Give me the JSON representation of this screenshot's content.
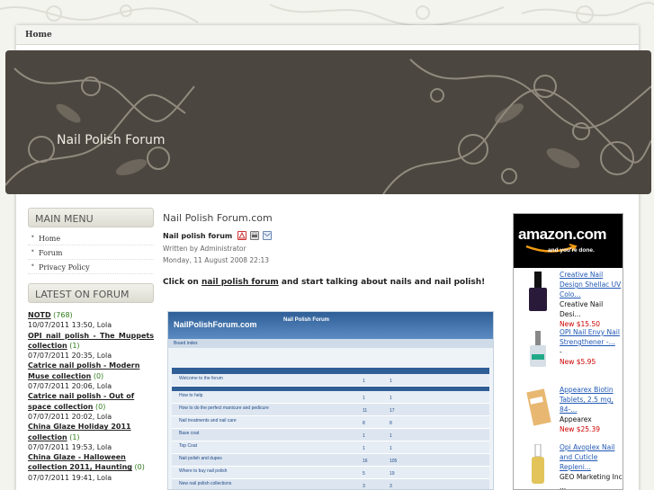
{
  "nav": {
    "home": "Home"
  },
  "banner": {
    "title": "Nail Polish Forum"
  },
  "main_menu": {
    "title": "MAIN MENU",
    "items": [
      {
        "label": "Home"
      },
      {
        "label": "Forum"
      },
      {
        "label": "Privacy Policy"
      }
    ]
  },
  "latest_forum": {
    "title": "LATEST ON FORUM",
    "posts": [
      {
        "title": "NOTD",
        "count": "(768)",
        "meta": "10/07/2011 13:50, Lola"
      },
      {
        "title": "OPI nail polish - The Muppets collection",
        "count": "(1)",
        "meta": "07/07/2011 20:35, Lola"
      },
      {
        "title": "Catrice nail polish - Modern Muse collection",
        "count": "(0)",
        "meta": "07/07/2011 20:06, Lola"
      },
      {
        "title": "Catrice nail polish - Out of space collection",
        "count": "(0)",
        "meta": "07/07/2011 20:02, Lola"
      },
      {
        "title": "China Glaze Holiday 2011 collection",
        "count": "(1)",
        "meta": "07/07/2011 19:53, Lola"
      },
      {
        "title": "China Glaze - Halloween collection 2011, Haunting",
        "count": "(0)",
        "meta": "07/07/2011 19:41, Lola"
      }
    ]
  },
  "content": {
    "site_title": "Nail Polish Forum.com",
    "article_title": "Nail polish forum",
    "written_by": "Written by Administrator",
    "date": "Monday, 11 August 2008 22:13",
    "cta_prefix": "Click on ",
    "cta_link": "nail polish forum",
    "cta_suffix": " and start talking about nails and nail polish!"
  },
  "embedded_screenshot": {
    "logo": "NailPolishForum.com",
    "header_title": "Nail Polish Forum",
    "board_index": "Board index",
    "rows": [
      {
        "name": "Welcome to the forum",
        "topics": "1",
        "posts": "1"
      },
      {
        "name": "How to help",
        "topics": "1",
        "posts": "1"
      },
      {
        "name": "How to do the perfect manicure and pedicure",
        "topics": "11",
        "posts": "17"
      },
      {
        "name": "Nail treatments and nail care",
        "topics": "8",
        "posts": "8"
      },
      {
        "name": "Base coat",
        "topics": "1",
        "posts": "1"
      },
      {
        "name": "Top Coat",
        "topics": "1",
        "posts": "1"
      },
      {
        "name": "Nail polish and dupes",
        "topics": "16",
        "posts": "105"
      },
      {
        "name": "Where to buy nail polish",
        "topics": "5",
        "posts": "19"
      },
      {
        "name": "New nail polish collections",
        "topics": "3",
        "posts": "3"
      }
    ]
  },
  "amazon": {
    "logo": "amazon.com",
    "tagline": "and you're done.",
    "products": [
      {
        "title": "Creative Nail Design Shellac UV Colo...",
        "brand": "Creative Nail Desi...",
        "price": "New $15.50",
        "color": "#2a1a3a"
      },
      {
        "title": "OPI Nail Envy Nail Strengthener -...",
        "brand": "-",
        "price": "New $5.95",
        "color": "#d6dfe6"
      },
      {
        "title": "Appearex Biotin Tablets, 2.5 mg, 84-...",
        "brand": "Appearex",
        "price": "New $25.39",
        "color": "#e8b872"
      },
      {
        "title": "Opi Avoplex Nail and Cuticle Repleni...",
        "brand": "GEO Marketing Inc ...",
        "price": "",
        "color": "#e2c45a"
      }
    ]
  }
}
